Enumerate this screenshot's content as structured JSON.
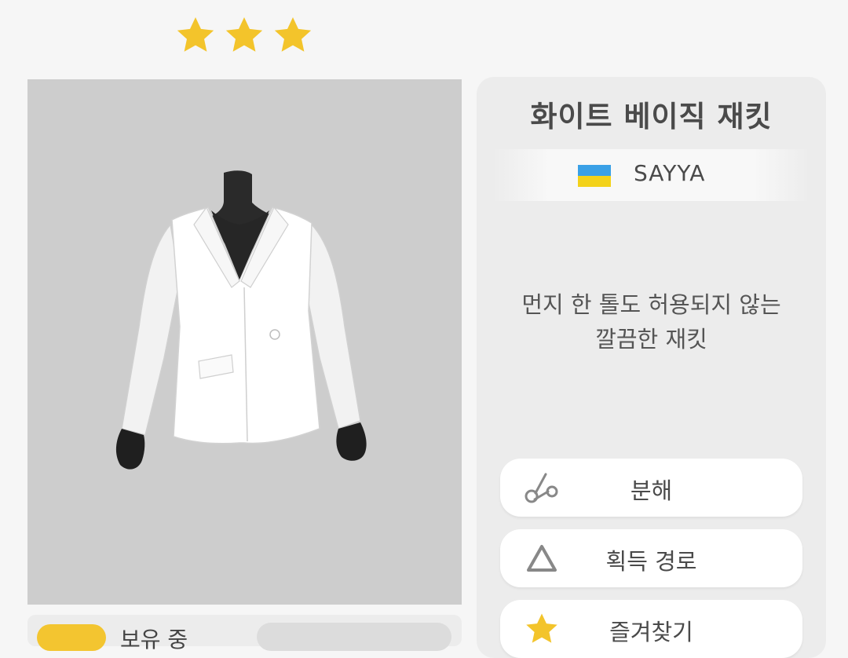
{
  "rarity": {
    "stars": 3,
    "star_color": "#f3c42b"
  },
  "item": {
    "name": "화이트 베이직 재킷",
    "brand": "SAYYA",
    "brand_flag_colors": [
      "#3aa0e6",
      "#f3d21a"
    ],
    "description_line1": "먼지 한 톨도 허용되지 않는",
    "description_line2": "깔끔한 재킷",
    "preview_background": "#cdcdcd"
  },
  "actions": {
    "disassemble_label": "분해",
    "acquire_path_label": "획득 경로",
    "favorite_label": "즐겨찾기"
  },
  "owned": {
    "label": "보유 중"
  }
}
